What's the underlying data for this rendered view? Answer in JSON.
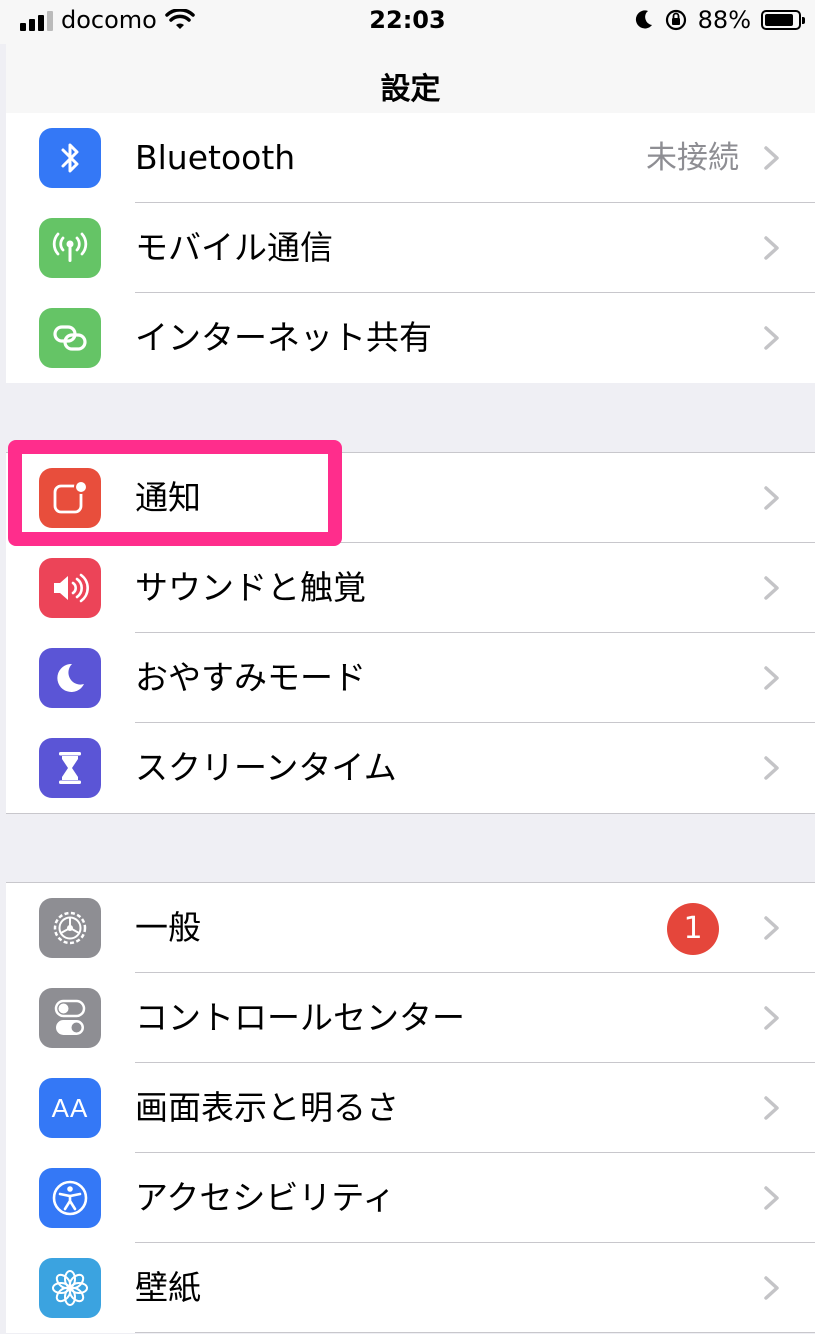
{
  "status_bar": {
    "carrier": "docomo",
    "time": "22:03",
    "battery_percent": "88%",
    "battery_level": 0.88
  },
  "nav": {
    "title": "設定"
  },
  "groups": [
    {
      "rows": [
        {
          "label": "Bluetooth",
          "value": "未接続",
          "icon": "bluetooth-icon",
          "color": "#3478f6"
        },
        {
          "label": "モバイル通信",
          "icon": "antenna-icon",
          "color": "#65c466"
        },
        {
          "label": "インターネット共有",
          "icon": "link-icon",
          "color": "#65c466"
        }
      ]
    },
    {
      "rows": [
        {
          "label": "通知",
          "icon": "notification-icon",
          "color": "#e84e3c"
        },
        {
          "label": "サウンドと触覚",
          "icon": "speaker-icon",
          "color": "#ec4458"
        },
        {
          "label": "おやすみモード",
          "icon": "moon-icon",
          "color": "#5b55d6"
        },
        {
          "label": "スクリーンタイム",
          "icon": "hourglass-icon",
          "color": "#5b55d6"
        }
      ]
    },
    {
      "rows": [
        {
          "label": "一般",
          "badge": "1",
          "icon": "gear-icon",
          "color": "#8e8e93"
        },
        {
          "label": "コントロールセンター",
          "icon": "toggles-icon",
          "color": "#8e8e93"
        },
        {
          "label": "画面表示と明るさ",
          "icon_text": "AA",
          "icon": "text-size-icon",
          "color": "#3478f6"
        },
        {
          "label": "アクセシビリティ",
          "icon": "accessibility-icon",
          "color": "#3478f6"
        },
        {
          "label": "壁紙",
          "icon": "flower-icon",
          "color": "#3ba3e0"
        }
      ]
    }
  ],
  "highlight_color": "#ff2d8c",
  "badge_color": "#e5463b"
}
